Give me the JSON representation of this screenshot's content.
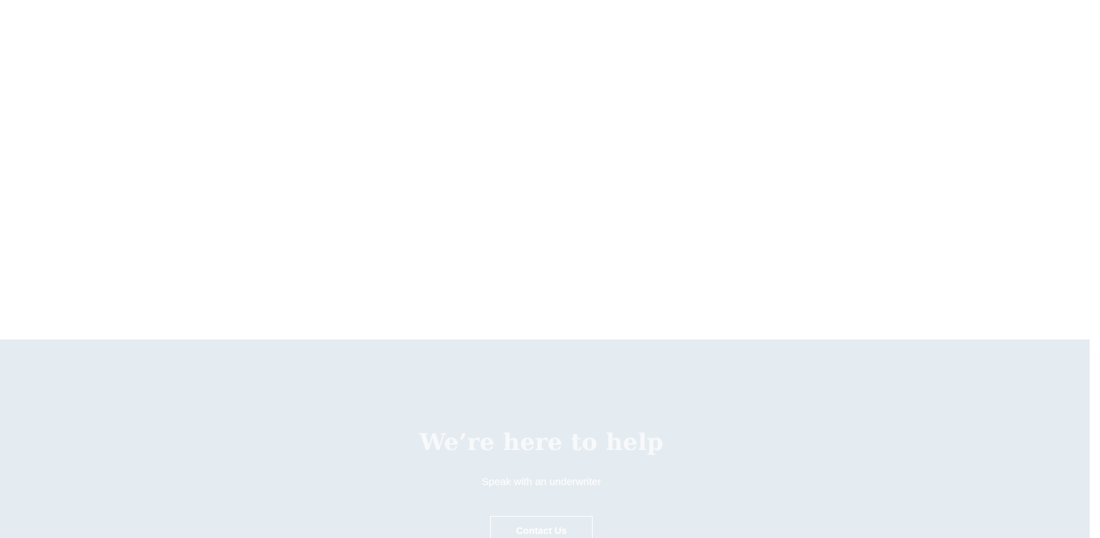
{
  "help_section": {
    "title": "We’re here to help",
    "subtitle": "Speak with an underwriter",
    "button_label": "Contact Us"
  },
  "colors": {
    "help_background": "#e5ecf1",
    "text": "#ffffff",
    "page_background": "#ffffff"
  }
}
